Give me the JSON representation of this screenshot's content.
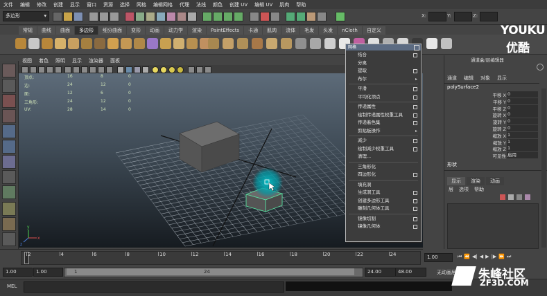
{
  "menubar": [
    "文件",
    "编辑",
    "修改",
    "创建",
    "显示",
    "窗口",
    "资源",
    "选择",
    "网格",
    "编辑网格",
    "代理",
    "法线",
    "颜色",
    "创建 UV",
    "编辑 UV",
    "肌肉",
    "帮助"
  ],
  "status": {
    "mode": "多边形",
    "x_label": "X:",
    "y_label": "Y:",
    "z_label": "Z:"
  },
  "shelf_tabs": [
    "常规",
    "曲线",
    "曲面",
    "多边形",
    "细分曲面",
    "变形",
    "动画",
    "动力学",
    "渲染",
    "PaintEffects",
    "卡通",
    "肌肉",
    "流体",
    "毛发",
    "头发",
    "nCloth",
    "自定义"
  ],
  "shelf_active_index": 3,
  "panel_menu": [
    "视图",
    "着色",
    "照明",
    "显示",
    "渲染器",
    "面板"
  ],
  "hud": {
    "rows": [
      {
        "label": "顶点:",
        "a": "16",
        "b": "8",
        "c": "0"
      },
      {
        "label": "边:",
        "a": "24",
        "b": "12",
        "c": "0"
      },
      {
        "label": "面:",
        "a": "12",
        "b": "6",
        "c": "0"
      },
      {
        "label": "三角形:",
        "a": "24",
        "b": "12",
        "c": "0"
      },
      {
        "label": "UV:",
        "a": "28",
        "b": "14",
        "c": "0"
      }
    ]
  },
  "popup": {
    "title": "网格",
    "items": [
      {
        "label": "结合",
        "type": "box"
      },
      {
        "label": "分离",
        "type": "none"
      },
      {
        "label": "提取",
        "type": "box"
      },
      {
        "label": "布尔",
        "type": "arrow"
      },
      {
        "sep": true
      },
      {
        "label": "平滑",
        "type": "box"
      },
      {
        "label": "平均化顶点",
        "type": "box"
      },
      {
        "sep": true
      },
      {
        "label": "传递属性",
        "type": "box"
      },
      {
        "label": "绘制传递属性权重工具",
        "type": "box"
      },
      {
        "label": "传递着色集",
        "type": "box"
      },
      {
        "label": "剪贴板操作",
        "type": "arrow"
      },
      {
        "sep": true
      },
      {
        "label": "减少",
        "type": "box"
      },
      {
        "label": "绘制减少权重工具",
        "type": "box"
      },
      {
        "label": "清理...",
        "type": "none"
      },
      {
        "sep": true
      },
      {
        "label": "三角形化",
        "type": "none"
      },
      {
        "label": "四边形化",
        "type": "box"
      },
      {
        "sep": true
      },
      {
        "label": "填充洞",
        "type": "none"
      },
      {
        "label": "生成洞工具",
        "type": "box"
      },
      {
        "label": "创建多边形工具",
        "type": "box"
      },
      {
        "label": "雕刻几何体工具",
        "type": "box"
      },
      {
        "sep": true
      },
      {
        "label": "镜像切割",
        "type": "box"
      },
      {
        "label": "镜像几何体",
        "type": "box"
      }
    ]
  },
  "channel_box": {
    "header": "通道盒/层编辑器",
    "menu": [
      "通道",
      "编辑",
      "对象",
      "显示"
    ],
    "object": "polySurface2",
    "channels": [
      {
        "name": "平移 X",
        "value": "0"
      },
      {
        "name": "平移 Y",
        "value": "0"
      },
      {
        "name": "平移 Z",
        "value": "0"
      },
      {
        "name": "旋转 X",
        "value": "0"
      },
      {
        "name": "旋转 Y",
        "value": "0"
      },
      {
        "name": "旋转 Z",
        "value": "0"
      },
      {
        "name": "缩放 X",
        "value": "1"
      },
      {
        "name": "缩放 Y",
        "value": "1"
      },
      {
        "name": "缩放 Z",
        "value": "1"
      },
      {
        "name": "可见性",
        "value": "启用"
      }
    ],
    "shapes_label": "形状",
    "layer_tabs": [
      "显示",
      "渲染",
      "动画"
    ],
    "layer_menu": [
      "层",
      "选项",
      "帮助"
    ]
  },
  "timeline": {
    "ticks": [
      "2",
      "4",
      "6",
      "8",
      "10",
      "12",
      "14",
      "16",
      "18",
      "20",
      "22",
      "24"
    ],
    "current": "1.00"
  },
  "range": {
    "start": "1.00",
    "play_start": "1.00",
    "slider_start": "1",
    "slider_end": "24",
    "play_end": "24.00",
    "end": "48.00",
    "char_set": "无动画层"
  },
  "mel": {
    "label": "MEL"
  },
  "watermarks": {
    "top": "YOUKU",
    "top_sub": "优酷",
    "bottom": "朱峰社区",
    "bottom_sub": "ZF3D.COM"
  },
  "colors": {
    "accent": "#5c6b82",
    "selection": "#58e0a0",
    "highlight": "#009aa6"
  }
}
